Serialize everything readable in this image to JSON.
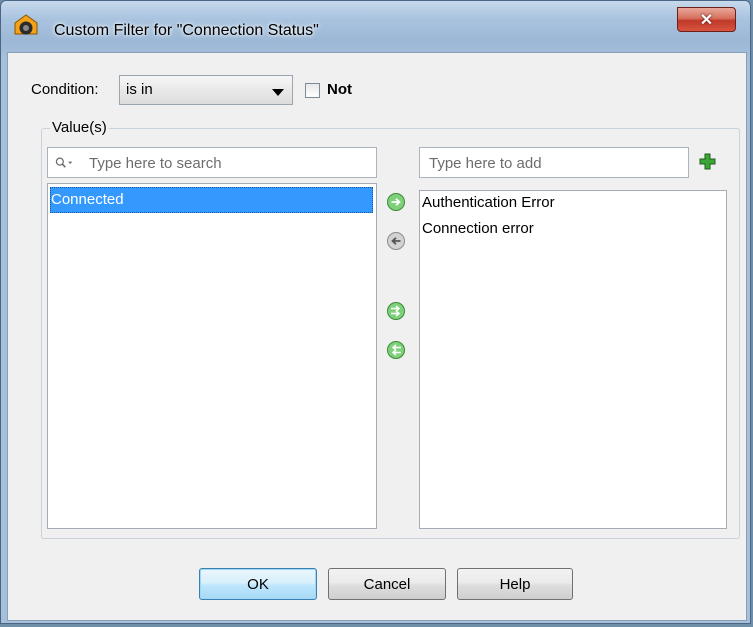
{
  "window": {
    "title": "Custom Filter for \"Connection Status\"",
    "close_glyph": "✕"
  },
  "condition": {
    "label": "Condition:",
    "selected": "is in",
    "not_label": "Not",
    "not_checked": false
  },
  "values_group": {
    "label": "Value(s)",
    "search_placeholder": "Type here to search",
    "add_placeholder": "Type here to add",
    "available": [
      "Connected"
    ],
    "available_selected_index": 0,
    "chosen": [
      "Authentication Error",
      "Connection error"
    ]
  },
  "icons": {
    "app": "rectifier-app-icon",
    "search": "search-icon",
    "add": "green-plus-icon",
    "move_right": "arrow-right-icon",
    "move_left": "arrow-left-icon",
    "move_all_right": "double-arrow-right-icon",
    "move_all_left": "double-arrow-left-icon",
    "accent_green": "#3aa635"
  },
  "buttons": {
    "ok": "OK",
    "cancel": "Cancel",
    "help": "Help"
  }
}
